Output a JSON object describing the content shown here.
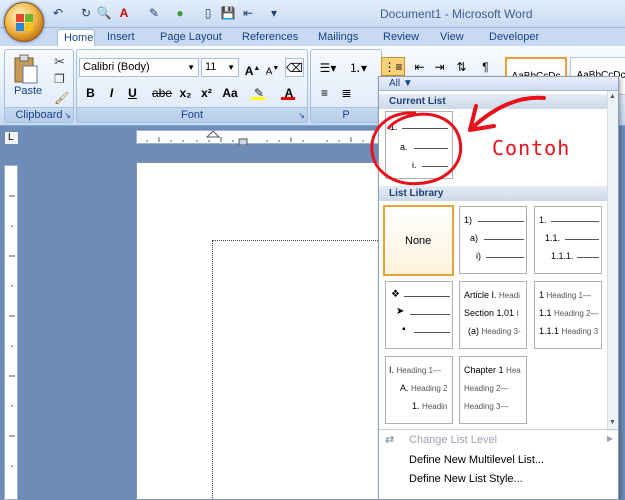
{
  "window": {
    "title": "Document1 - Microsoft Word"
  },
  "tabs": [
    "Home",
    "Insert",
    "Page Layout",
    "References",
    "Mailings",
    "Review",
    "View",
    "Developer"
  ],
  "clipboard": {
    "paste_label": "Paste",
    "group_label": "Clipboard"
  },
  "font": {
    "family": "Calibri (Body)",
    "size": "11",
    "group_label": "Font",
    "bold": "B",
    "italic": "I",
    "underline": "U",
    "strike": "abe",
    "sub": "x₂",
    "sup": "x²",
    "case": "Aa",
    "grow": "A",
    "shrink": "A"
  },
  "paragraph": {
    "group_label": "P"
  },
  "styles": {
    "sample1": "AaBbCcDc",
    "sample2": "AaBbCcDc"
  },
  "panel": {
    "filter_label": "All",
    "current_list_header": "Current List",
    "current_list": {
      "l1": "1.",
      "l2": "a.",
      "l3": "i."
    },
    "library_header": "List Library",
    "none_label": "None",
    "t2": {
      "l1": "1)",
      "l2": "a)",
      "l3": "i)"
    },
    "t3": {
      "l1": "1.",
      "l2": "1.1.",
      "l3": "1.1.1."
    },
    "t5": {
      "l1": "Article I.",
      "l1s": "Headi",
      "l2": "Section 1.01",
      "l2s": "I",
      "l3": "(a)",
      "l3s": "Heading 3-"
    },
    "t6": {
      "l1": "1",
      "l1s": "Heading 1—",
      "l2": "1.1",
      "l2s": "Heading 2—",
      "l3": "1.1.1",
      "l3s": "Heading 3"
    },
    "t7": {
      "l1": "I.",
      "l1s": "Heading 1—",
      "l2": "A.",
      "l2s": "Heading 2",
      "l3": "1.",
      "l3s": "Headin"
    },
    "t8": {
      "l1": "Chapter 1",
      "l1s": "Hea",
      "l2s": "Heading 2—",
      "l3s": "Heading 3—"
    },
    "menu": {
      "change_level": "Change List Level",
      "define_list": "Define New Multilevel List...",
      "define_style": "Define New List Style..."
    }
  },
  "annotation": {
    "text": "Contoh",
    "color": "#e8101a"
  }
}
